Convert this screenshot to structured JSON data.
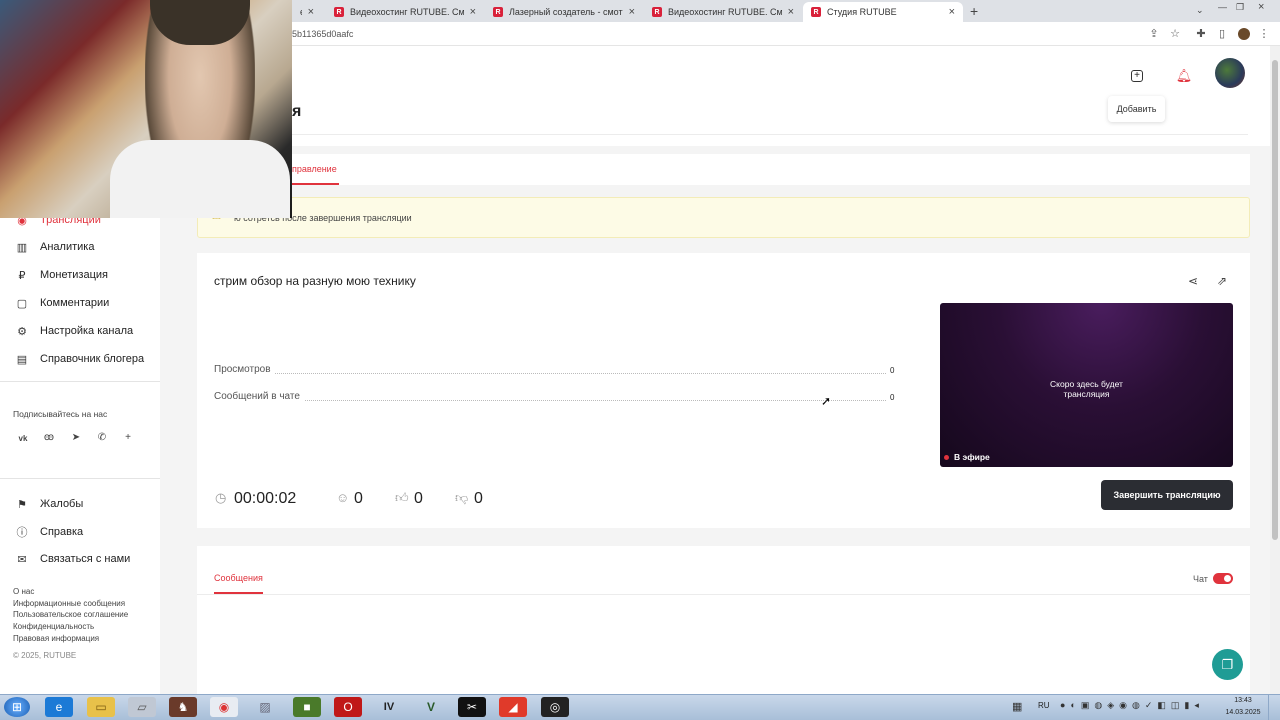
{
  "browser": {
    "tabs": [
      {
        "label": "Видеохостинг RUTUBE. Смотрит..."
      },
      {
        "label": "Лазерный создатель - смотреть..."
      },
      {
        "label": "Видеохостинг RUTUBE. Смотрит..."
      },
      {
        "label": "Студия RUTUBE"
      }
    ],
    "partial_tab": "ет",
    "url": "5b11365d0aafc"
  },
  "header": {
    "add_tooltip": "Добавить",
    "title_fragment": "я"
  },
  "tabs_row": {
    "active_tab": "правление"
  },
  "notice": {
    "text": "ю сотретсь после завершения трансляции"
  },
  "sidebar": {
    "partial_item": "Трансляции",
    "items": [
      {
        "label": "Аналитика",
        "icon": "bar-chart-icon"
      },
      {
        "label": "Монетизация",
        "icon": "ruble-icon"
      },
      {
        "label": "Комментарии",
        "icon": "comment-icon"
      },
      {
        "label": "Настройка канала",
        "icon": "gear-icon"
      },
      {
        "label": "Справочник блогера",
        "icon": "book-icon"
      }
    ],
    "subscribe_label": "Подписывайтесь на нас",
    "bottom_items": [
      {
        "label": "Жалобы",
        "icon": "flag-icon"
      },
      {
        "label": "Справка",
        "icon": "help-icon"
      },
      {
        "label": "Связаться с нами",
        "icon": "mail-icon"
      }
    ],
    "footer_links": [
      "О нас",
      "Информационные сообщения",
      "Пользовательское соглашение",
      "Конфиденциальность",
      "Правовая информация"
    ],
    "copyright": "© 2025, RUTUBE"
  },
  "stream": {
    "title": "стрим обзор на разную мою технику",
    "stats": [
      {
        "label": "Просмотров",
        "value": "0"
      },
      {
        "label": "Сообщений в чате",
        "value": "0"
      }
    ],
    "timer": "00:00:02",
    "viewers": "0",
    "likes": "0",
    "dislikes": "0",
    "preview_text": "Скоро здесь будет трансляция",
    "live_badge": "В эфире",
    "end_button": "Завершить трансляцию"
  },
  "chat": {
    "tab_label": "Сообщения",
    "toggle_label": "Чат",
    "toggle_on": true
  },
  "taskbar": {
    "lang": "RU",
    "time": "13:43",
    "date": "14.03.2025"
  },
  "colors": {
    "accent": "#e0333d",
    "notice_bg": "#fdfbe6",
    "button_dark": "#2b2d33"
  }
}
